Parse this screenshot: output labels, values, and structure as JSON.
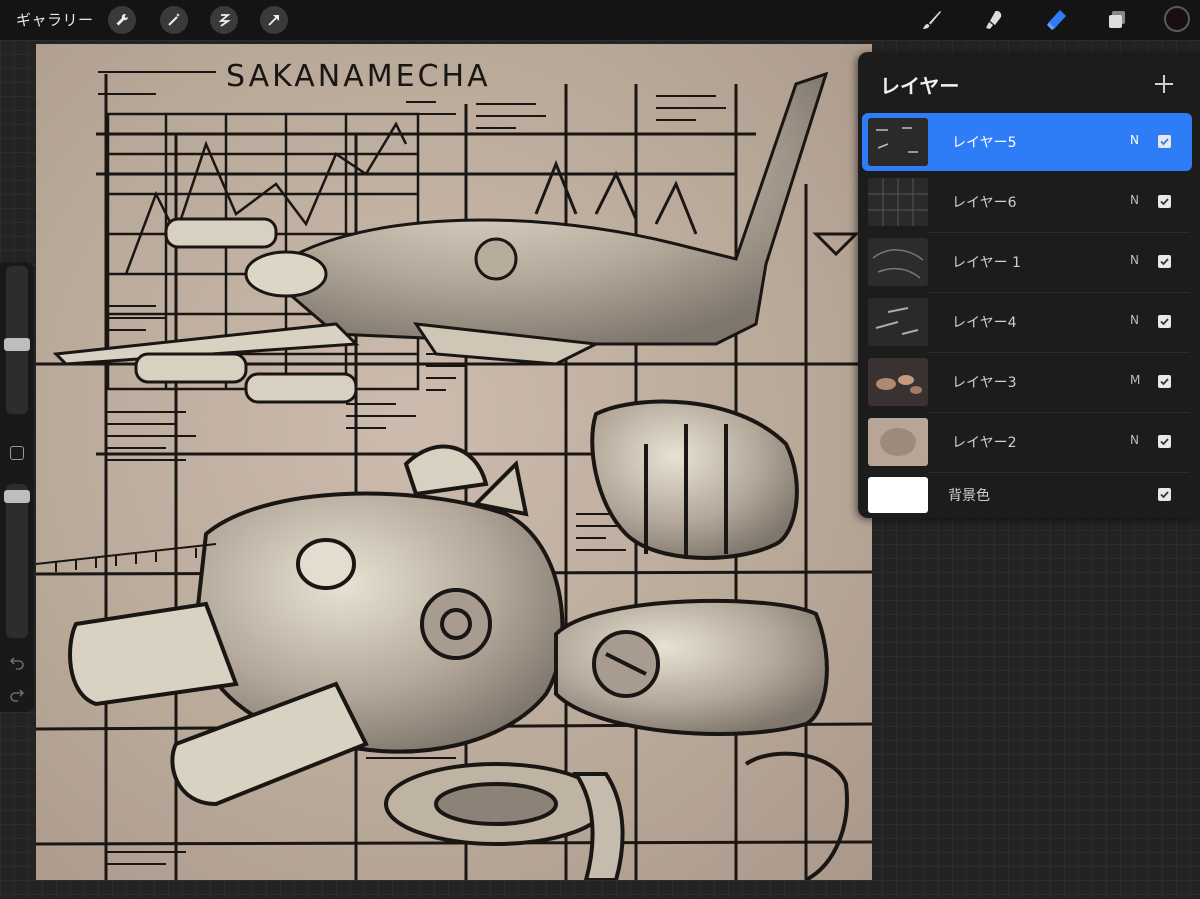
{
  "topbar": {
    "gallery_label": "ギャラリー",
    "left_tools": [
      "wrench-icon",
      "magic-wand-icon",
      "selection-icon",
      "transform-arrow-icon"
    ],
    "right_tools": [
      "brush-icon",
      "smudge-icon",
      "eraser-icon",
      "layers-icon"
    ],
    "active_tool": "eraser-icon",
    "current_color": "#1a0e10"
  },
  "canvas": {
    "title_text": "SAKANAMECHA",
    "background_color": "#c9b7a6"
  },
  "layers_panel": {
    "title": "レイヤー",
    "layers": [
      {
        "name": "レイヤー5",
        "mode": "N",
        "visible": true,
        "active": true
      },
      {
        "name": "レイヤー6",
        "mode": "N",
        "visible": true,
        "active": false
      },
      {
        "name": "レイヤー 1",
        "mode": "N",
        "visible": true,
        "active": false
      },
      {
        "name": "レイヤー4",
        "mode": "N",
        "visible": true,
        "active": false
      },
      {
        "name": "レイヤー3",
        "mode": "M",
        "visible": true,
        "active": false
      },
      {
        "name": "レイヤー2",
        "mode": "N",
        "visible": true,
        "active": false
      }
    ],
    "background_layer": {
      "name": "背景色",
      "visible": true
    }
  },
  "sidebar": {
    "brush_size": 0.3,
    "opacity": 0.85
  },
  "colors": {
    "accent": "#2f7df6",
    "panel_bg": "#1c1c1c"
  }
}
